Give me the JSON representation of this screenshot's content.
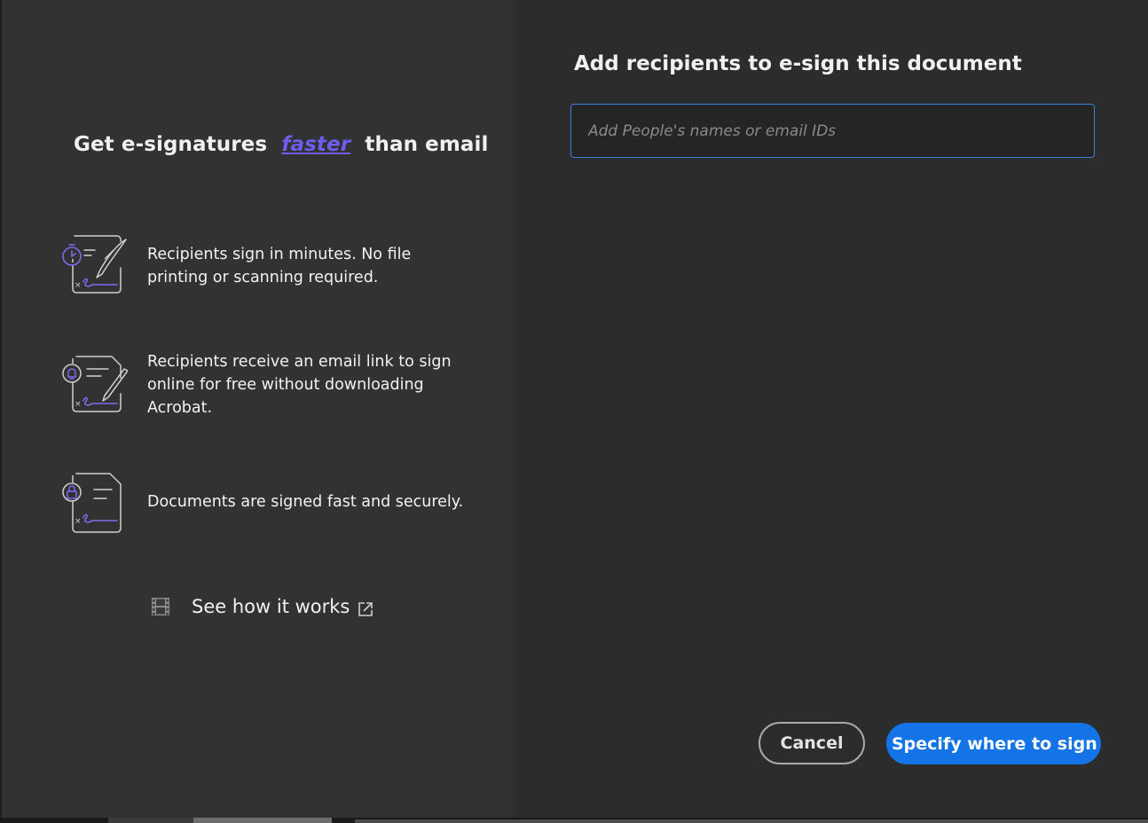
{
  "promo": {
    "title_before": "Get e-signatures",
    "title_emphasis": "faster",
    "title_after": "than email",
    "features": [
      {
        "icon": "sign-in-minutes-icon",
        "text": "Recipients sign in minutes. No file printing or scanning required."
      },
      {
        "icon": "email-link-sign-icon",
        "text": "Recipients receive an email link to sign online for free without downloading Acrobat."
      },
      {
        "icon": "secure-document-icon",
        "text": "Documents are signed fast and securely."
      }
    ],
    "how_link": "See how it works"
  },
  "recipients": {
    "title": "Add recipients to e-sign this document",
    "input_placeholder": "Add People's names or email IDs",
    "input_value": ""
  },
  "actions": {
    "cancel_label": "Cancel",
    "primary_label": "Specify where to sign"
  },
  "colors": {
    "accent": "#6f5cf0",
    "primary": "#1473e6",
    "input_border": "#3f7ed6"
  }
}
